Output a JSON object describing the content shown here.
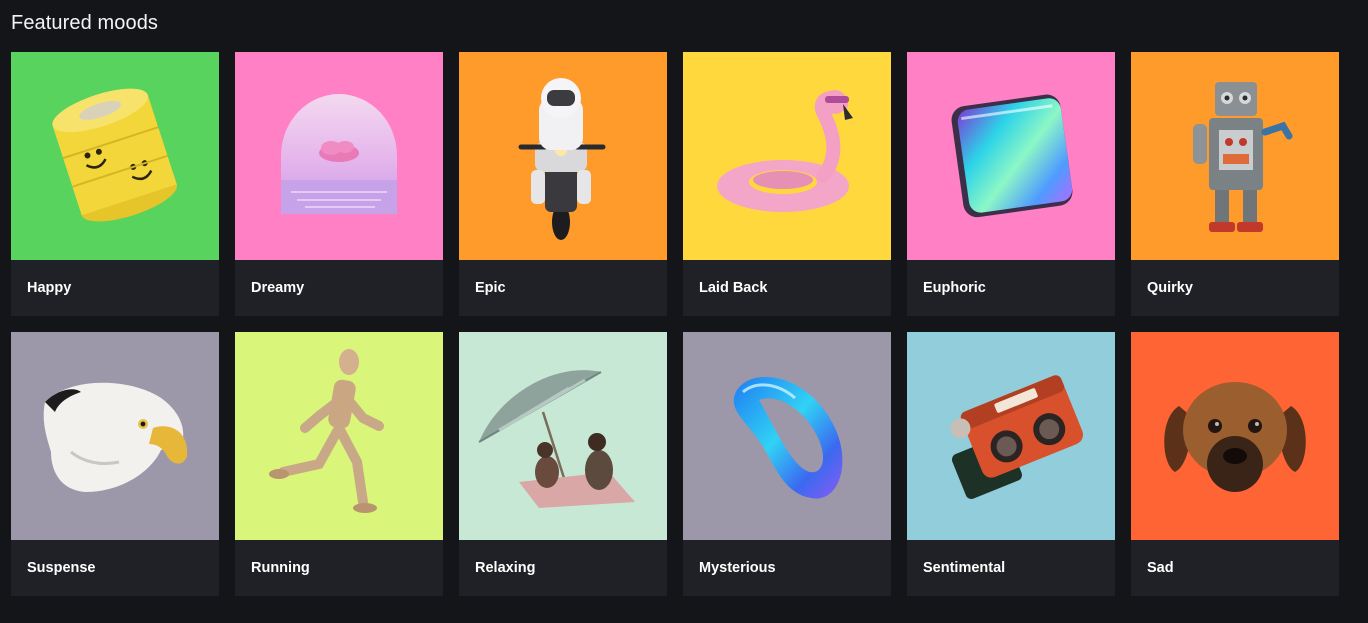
{
  "section": {
    "title": "Featured moods"
  },
  "moods": [
    {
      "label": "Happy",
      "color": "#57d35e",
      "icon": "smiley-tape-icon"
    },
    {
      "label": "Dreamy",
      "color": "#ff80c5",
      "icon": "arch-cloud-icon"
    },
    {
      "label": "Epic",
      "color": "#ff9b2b",
      "icon": "astronaut-motorcycle-icon"
    },
    {
      "label": "Laid Back",
      "color": "#ffd83d",
      "icon": "flamingo-float-icon"
    },
    {
      "label": "Euphoric",
      "color": "#ff80c5",
      "icon": "iridescent-cube-icon"
    },
    {
      "label": "Quirky",
      "color": "#ff9b2b",
      "icon": "toy-robot-icon"
    },
    {
      "label": "Suspense",
      "color": "#9c98aa",
      "icon": "eagle-icon"
    },
    {
      "label": "Running",
      "color": "#d9f57a",
      "icon": "wooden-mannequin-icon"
    },
    {
      "label": "Relaxing",
      "color": "#c8e8d6",
      "icon": "beach-umbrella-icon"
    },
    {
      "label": "Mysterious",
      "color": "#9c98aa",
      "icon": "glass-ring-icon"
    },
    {
      "label": "Sentimental",
      "color": "#91cdda",
      "icon": "viewmaster-icon"
    },
    {
      "label": "Sad",
      "color": "#ff6435",
      "icon": "puppy-icon"
    }
  ]
}
